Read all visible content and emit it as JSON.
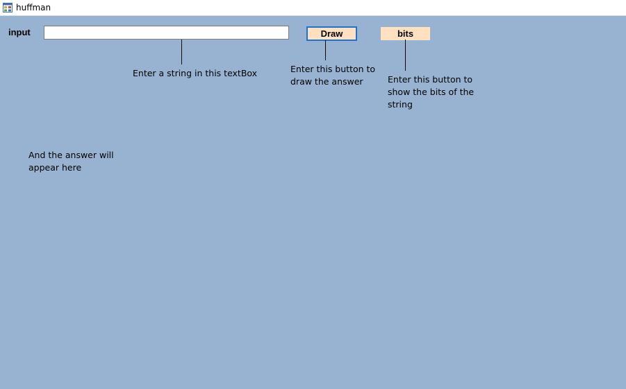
{
  "window": {
    "title": "huffman",
    "icon": "app-form-icon",
    "background": "#97b3d1"
  },
  "form": {
    "input_label": "input",
    "input_value": "",
    "draw_button": "Draw",
    "bits_button": "bits",
    "button_color": "#ffe1c0",
    "focus_border_color": "#1d74d0"
  },
  "hints": {
    "textbox_hint": "Enter a string in this textBox",
    "draw_hint": "Enter this button to\ndraw the answer",
    "bits_hint": "Enter this button to\nshow the bits of the\nstring",
    "answer_hint": "And the answer will\nappear here"
  }
}
